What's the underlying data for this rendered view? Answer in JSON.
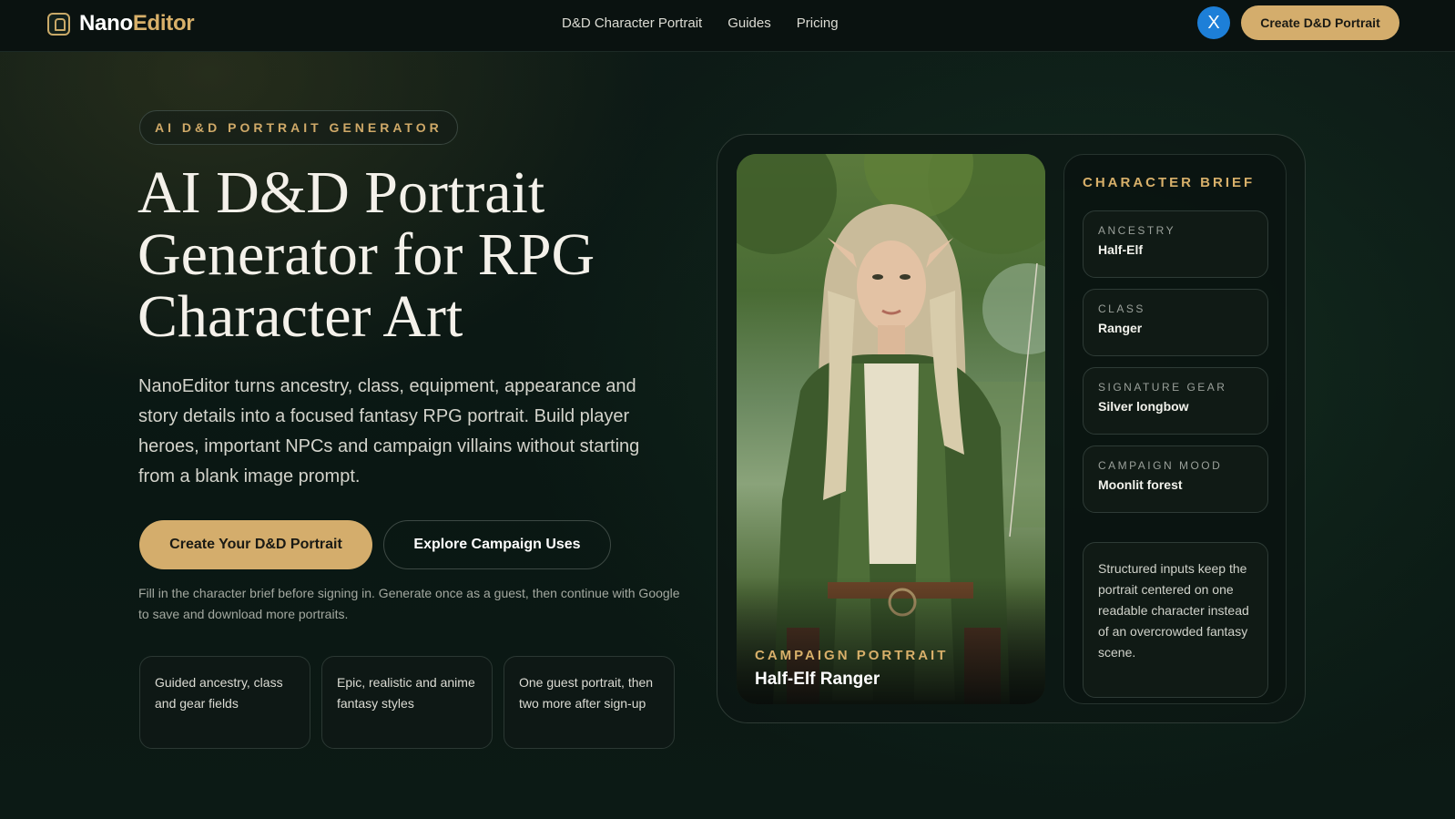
{
  "nav": {
    "brand_part1": "Nano",
    "brand_part2": "Editor",
    "links": [
      "D&D Character Portrait",
      "Guides",
      "Pricing"
    ],
    "avatar_initial": "X",
    "cta_label": "Create D&D Portrait"
  },
  "hero": {
    "eyebrow": "AI D&D PORTRAIT GENERATOR",
    "title": "AI D&D Portrait Generator for RPG Character Art",
    "description": "NanoEditor turns ancestry, class, equipment, appearance and story details into a focused fantasy RPG portrait. Build player heroes, important NPCs and campaign villains without starting from a blank image prompt.",
    "primary_button": "Create Your D&D Portrait",
    "secondary_button": "Explore Campaign Uses",
    "note": "Fill in the character brief before signing in. Generate once as a guest, then continue with Google to save and download more portraits.",
    "features": [
      "Guided ancestry, class and gear fields",
      "Epic, realistic and anime fantasy styles",
      "One guest portrait, then two more after sign-up"
    ]
  },
  "portrait": {
    "label": "CAMPAIGN PORTRAIT",
    "name": "Half-Elf Ranger"
  },
  "brief": {
    "title": "CHARACTER BRIEF",
    "fields": [
      {
        "label": "ANCESTRY",
        "value": "Half-Elf"
      },
      {
        "label": "CLASS",
        "value": "Ranger"
      },
      {
        "label": "SIGNATURE GEAR",
        "value": "Silver longbow"
      },
      {
        "label": "CAMPAIGN MOOD",
        "value": "Moonlit forest"
      }
    ],
    "note": "Structured inputs keep the portrait centered on one readable character instead of an overcrowded fantasy scene."
  },
  "colors": {
    "accent": "#d4ad6c",
    "background": "#0b1512",
    "avatar": "#1d7fd8"
  }
}
